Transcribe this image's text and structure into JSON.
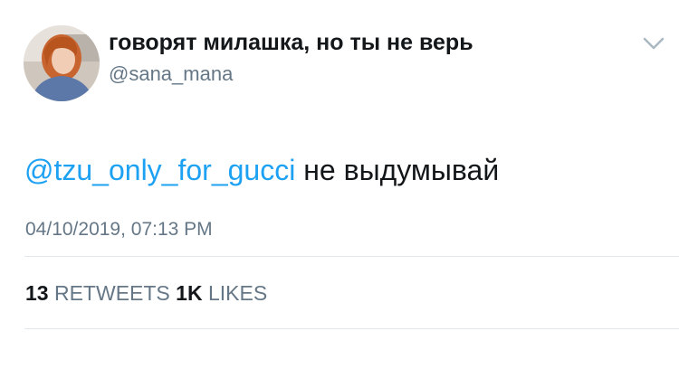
{
  "header": {
    "display_name": "говорят милашка, но ты не верь",
    "username": "@sana_mana"
  },
  "tweet": {
    "mention": "@tzu_only_for_gucci",
    "text": " не выдумывай",
    "timestamp": "04/10/2019, 07:13 PM"
  },
  "stats": {
    "retweets_count": "13",
    "retweets_label": " RETWEETS ",
    "likes_count": "1K",
    "likes_label": " LIKES"
  },
  "colors": {
    "mention": "#1da1f2",
    "secondary_text": "#657786",
    "primary_text": "#14171a",
    "divider": "#e1e8ed"
  },
  "icons": {
    "menu": "chevron-down-icon"
  }
}
